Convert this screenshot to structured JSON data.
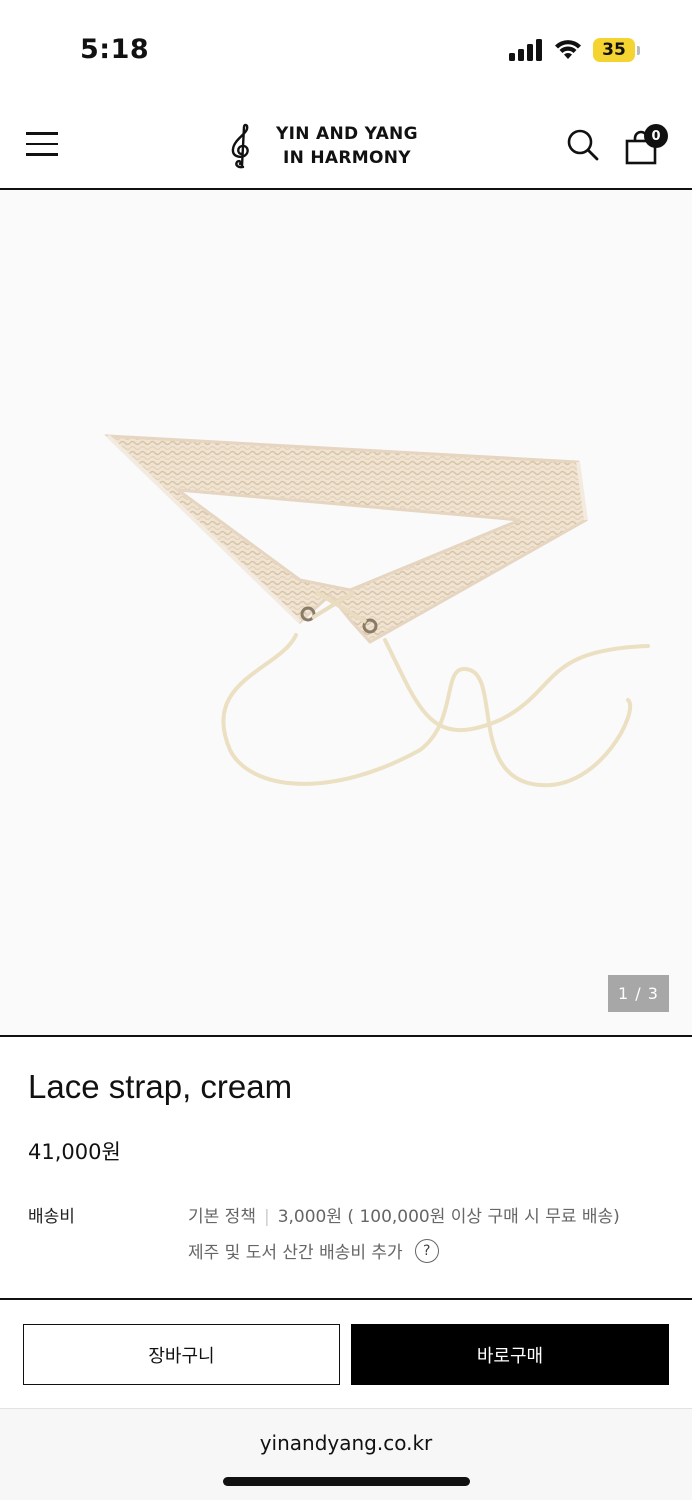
{
  "status_bar": {
    "time": "5:18",
    "battery": "35",
    "icons": [
      "signal-icon",
      "wifi-icon",
      "battery-icon"
    ]
  },
  "header": {
    "brand_line1": "YIN AND YANG",
    "brand_line2": "IN HARMONY",
    "cart_count": "0",
    "icons": [
      "menu-icon",
      "treble-clef-logo-icon",
      "search-icon",
      "shopping-bag-icon"
    ]
  },
  "gallery": {
    "counter": "1 / 3"
  },
  "product": {
    "name": "Lace strap, cream",
    "price": "41,000원"
  },
  "shipping": {
    "label": "배송비",
    "policy": "기본 정책",
    "fee": "3,000원 ( 100,000원 이상 구매 시 무료 배송)",
    "extra": "제주 및 도서 산간 배송비 추가",
    "help": "?"
  },
  "actions": {
    "cart_label": "장바구니",
    "buy_label": "바로구매"
  },
  "browser": {
    "url": "yinandyang.co.kr"
  },
  "colors": {
    "accent": "#000000",
    "battery": "#f5d431",
    "counter_bg": "#a7a7a7",
    "product": "#efe3d2"
  }
}
